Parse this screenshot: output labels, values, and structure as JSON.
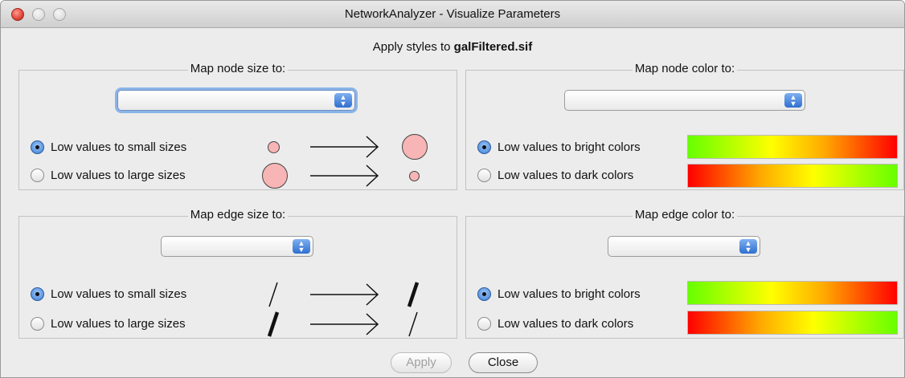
{
  "window": {
    "title": "NetworkAnalyzer - Visualize Parameters"
  },
  "header": {
    "apply_prefix": "Apply styles to ",
    "file_name": "galFiltered.sif"
  },
  "panels": {
    "node_size": {
      "legend": "Map node size to:",
      "selected": "",
      "option_small": "Low values to small sizes",
      "option_large": "Low values to large sizes",
      "selected_option": "small"
    },
    "node_color": {
      "legend": "Map node color to:",
      "selected": "",
      "option_bright": "Low values to bright colors",
      "option_dark": "Low values to dark colors",
      "selected_option": "bright"
    },
    "edge_size": {
      "legend": "Map edge size to:",
      "selected": "",
      "option_small": "Low values to small sizes",
      "option_large": "Low values to large sizes",
      "selected_option": "small"
    },
    "edge_color": {
      "legend": "Map edge color to:",
      "selected": "",
      "option_bright": "Low values to bright colors",
      "option_dark": "Low values to dark colors",
      "selected_option": "bright"
    }
  },
  "colors": {
    "node_fill": "#f7b5b5",
    "select_focus": "#8ab4e8",
    "radio_selected": "#3b7fd8",
    "gradient_green": "#66ff00",
    "gradient_yellow": "#ffff00",
    "gradient_red": "#ff0000"
  },
  "icons": {
    "stepper": "up-down-chevron-icon",
    "arrow": "right-arrow-icon"
  },
  "buttons": {
    "apply": "Apply",
    "close": "Close",
    "apply_enabled": false
  }
}
